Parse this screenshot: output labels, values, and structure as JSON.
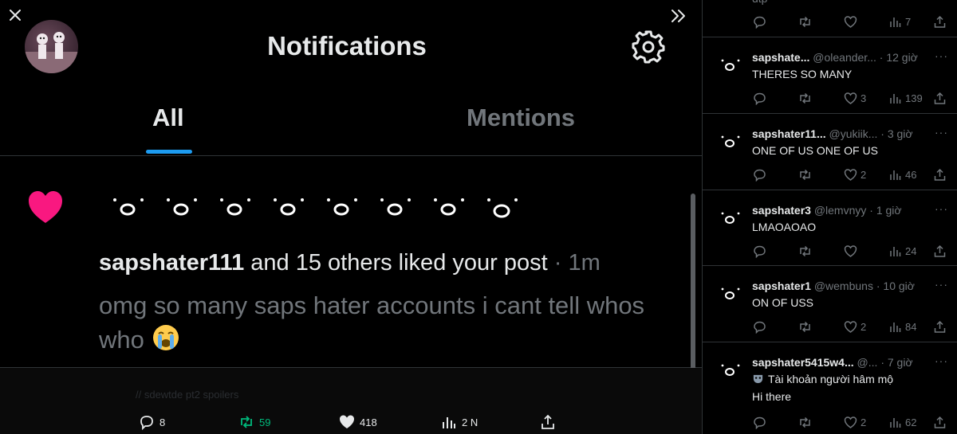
{
  "notifications": {
    "title": "Notifications",
    "tabs": [
      {
        "label": "All"
      },
      {
        "label": "Mentions"
      }
    ],
    "item": {
      "user": "sapshater111",
      "action": " and 15 others liked your post",
      "time": " · 1m",
      "post_text": "omg so many saps hater accounts i cant tell whos who"
    },
    "liker_count": 8
  },
  "action_bar": {
    "replies": "8",
    "reposts": "59",
    "likes": "418",
    "views": "2 N"
  },
  "dim_background": {
    "text": "// sdewtde pt2 spoilers"
  },
  "replies": [
    {
      "name": "",
      "handle": "",
      "time": "",
      "text": "dtp",
      "replies": "",
      "reposts": "",
      "likes": "",
      "views": "7"
    },
    {
      "name": "sapshate...",
      "handle": "@oleander...",
      "time": "· 12 giờ",
      "text": "THERES SO MANY",
      "likes": "3",
      "views": "139"
    },
    {
      "name": "sapshater11...",
      "handle": "@yukiik...",
      "time": "· 3 giờ",
      "text": "ONE OF US ONE OF US",
      "likes": "2",
      "views": "46"
    },
    {
      "name": "sapshater3",
      "handle": "@lemvnyy",
      "time": "· 1 giờ",
      "text": "LMAOAOAO",
      "likes": "",
      "views": "24"
    },
    {
      "name": "sapshater1",
      "handle": "@wembuns",
      "time": "· 10 giờ",
      "text": "ON OF USS",
      "likes": "2",
      "views": "84"
    },
    {
      "name": "sapshater5415w4...",
      "handle": "@...",
      "time": "· 7 giờ",
      "badge": "Tài khoản người hâm mộ",
      "text": "Hi there",
      "likes": "2",
      "views": "62"
    }
  ],
  "colors": {
    "accent": "#1d9bf0",
    "like": "#f91880",
    "repost": "#00ba7c",
    "muted": "#71767b"
  }
}
